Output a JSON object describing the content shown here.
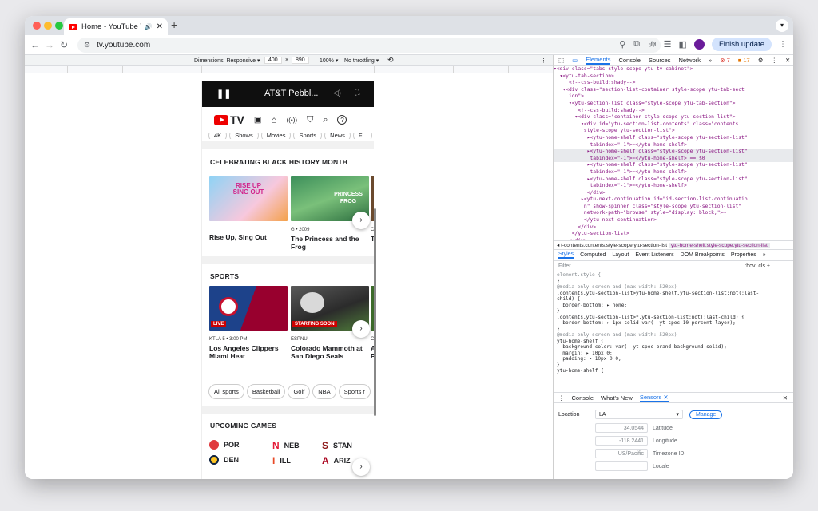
{
  "browser": {
    "tab_title": "Home - YouTube TV",
    "url": "tv.youtube.com",
    "finish_update": "Finish update",
    "colors": {
      "accent": "#1a73e8",
      "finish_bg": "#d3e3fd"
    }
  },
  "device_toolbar": {
    "dimensions_label": "Dimensions: Responsive",
    "width": "400",
    "times": "×",
    "height": "890",
    "zoom": "100%",
    "throttling": "No throttling"
  },
  "app": {
    "player": {
      "title": "AT&T Pebbl..."
    },
    "nav": {
      "logo_text": "TV"
    },
    "top_chips": [
      "4K",
      "Shows",
      "Movies",
      "Sports",
      "News",
      "F..."
    ],
    "sections": [
      {
        "title": "CELEBRATING BLACK HISTORY MONTH",
        "cards": [
          {
            "caption": "",
            "title": "Rise Up, Sing Out",
            "thumb_text": "RISE UP SING OUT"
          },
          {
            "caption": "G • 2009",
            "title": "The Princess and the Frog",
            "thumb_text": "PRINCESS FROG"
          },
          {
            "caption": "C",
            "title": "T"
          }
        ]
      },
      {
        "title": "SPORTS",
        "cards": [
          {
            "caption": "KTLA 5 • 3:00 PM",
            "title": "Los Angeles Clippers Miami Heat",
            "badge": "LIVE"
          },
          {
            "caption": "ESPNU",
            "title": "Colorado Mammoth at San Diego Seals",
            "badge": "STARTING SOON"
          },
          {
            "caption": "C",
            "title": "A P"
          }
        ],
        "chips": [
          "All sports",
          "Basketball",
          "Golf",
          "NBA",
          "Sports r"
        ]
      },
      {
        "title": "UPCOMING GAMES",
        "games": [
          {
            "left": "POR",
            "right": "NEB",
            "third": "STAN"
          },
          {
            "left": "DEN",
            "right": "ILL",
            "third": "ARIZ"
          }
        ]
      }
    ]
  },
  "devtools": {
    "tabs": [
      "Elements",
      "Console",
      "Sources",
      "Network",
      "»"
    ],
    "errors": "7",
    "warnings": "17",
    "dom_lines": [
      "▾<div class=\"tabs style-scope ytu-tv-cabinet\">",
      "  ▾<ytu-tab-section>",
      "     <!--css-build:shady-->",
      "   ▾<div class=\"section-list-container style-scope ytu-tab-sect",
      "     ion\">",
      "     ▾<ytu-section-list class=\"style-scope ytu-tab-section\">",
      "        <!--css-build:shady-->",
      "       ▾<div class=\"container style-scope ytu-section-list\">",
      "         ▾<div id=\"ytu-section-list-contents\" class=\"contents",
      "          style-scope ytu-section-list\">",
      "           ▸<ytu-home-shelf class=\"style-scope ytu-section-list\"",
      "            tabindex=\"-1\">⋯</ytu-home-shelf>",
      "           ▸<ytu-home-shelf class=\"style-scope ytu-section-list\"",
      "            tabindex=\"-1\">⋯</ytu-home-shelf> == $0",
      "           ▸<ytu-home-shelf class=\"style-scope ytu-section-list\"",
      "            tabindex=\"-1\">⋯</ytu-home-shelf>",
      "           ▸<ytu-home-shelf class=\"style-scope ytu-section-list\"",
      "            tabindex=\"-1\">⋯</ytu-home-shelf>",
      "           </div>",
      "         ▸<ytu-next-continuation id=\"id-section-list-continuatio",
      "          n\" show-spinner class=\"style-scope ytu-section-list\"",
      "          network-path=\"browse\" style=\"display: block;\">⋯",
      "          </ytu-next-continuation>",
      "        </div>",
      "      </ytu-section-list>",
      "     </div>"
    ],
    "breadcrumb_1": "t-contents.contents.style-scope.ytu-section-list",
    "breadcrumb_2": "ytu-home-shelf.style-scope.ytu-section-list",
    "styles_tabs": [
      "Styles",
      "Computed",
      "Layout",
      "Event Listeners",
      "DOM Breakpoints",
      "Properties",
      "»"
    ],
    "filter_placeholder": "Filter",
    "filter_right": ":hov  .cls  +",
    "style_rules": [
      "element.style {",
      "}",
      "@media only screen and (max-width: 520px)",
      ".contents.ytu-section-list>ytu-home-shelf.ytu-section-list:not(:last-",
      "child) {",
      "  border-bottom: ▸ none;",
      "}",
      ".contents.ytu-section-list>*.ytu-section-list:not(:last-child) {",
      "  border-bottom: ▸ 1px solid var(--yt-spec-10-percent-layer);",
      "}",
      "@media only screen and (max-width: 520px)",
      "ytu-home-shelf {",
      "  background-color: var(--yt-spec-brand-background-solid);",
      "  margin: ▸ 10px 0;",
      "  padding: ▸ 10px 0 0;",
      "}",
      "ytu-home-shelf {"
    ],
    "style_source": "<style>",
    "drawer_tabs": [
      "Console",
      "What's New",
      "Sensors"
    ],
    "sensors": {
      "location_label": "Location",
      "location_value": "LA",
      "manage": "Manage",
      "latitude": "34.0544",
      "latitude_label": "Latitude",
      "longitude": "-118.2441",
      "longitude_label": "Longitude",
      "timezone": "US/Pacific",
      "timezone_label": "Timezone ID",
      "locale_label": "Locale"
    }
  }
}
